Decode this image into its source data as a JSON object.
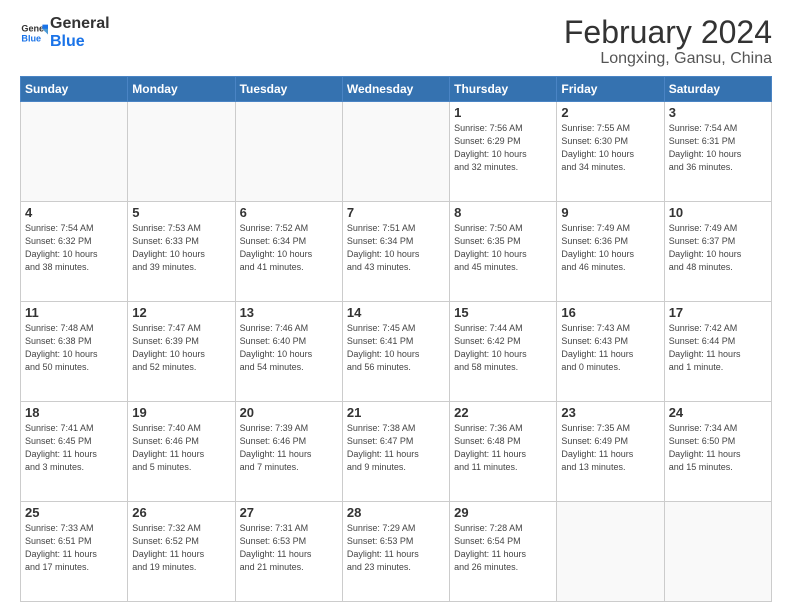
{
  "logo": {
    "line1": "General",
    "line2": "Blue"
  },
  "title": "February 2024",
  "subtitle": "Longxing, Gansu, China",
  "header_days": [
    "Sunday",
    "Monday",
    "Tuesday",
    "Wednesday",
    "Thursday",
    "Friday",
    "Saturday"
  ],
  "weeks": [
    [
      {
        "day": "",
        "info": ""
      },
      {
        "day": "",
        "info": ""
      },
      {
        "day": "",
        "info": ""
      },
      {
        "day": "",
        "info": ""
      },
      {
        "day": "1",
        "info": "Sunrise: 7:56 AM\nSunset: 6:29 PM\nDaylight: 10 hours\nand 32 minutes."
      },
      {
        "day": "2",
        "info": "Sunrise: 7:55 AM\nSunset: 6:30 PM\nDaylight: 10 hours\nand 34 minutes."
      },
      {
        "day": "3",
        "info": "Sunrise: 7:54 AM\nSunset: 6:31 PM\nDaylight: 10 hours\nand 36 minutes."
      }
    ],
    [
      {
        "day": "4",
        "info": "Sunrise: 7:54 AM\nSunset: 6:32 PM\nDaylight: 10 hours\nand 38 minutes."
      },
      {
        "day": "5",
        "info": "Sunrise: 7:53 AM\nSunset: 6:33 PM\nDaylight: 10 hours\nand 39 minutes."
      },
      {
        "day": "6",
        "info": "Sunrise: 7:52 AM\nSunset: 6:34 PM\nDaylight: 10 hours\nand 41 minutes."
      },
      {
        "day": "7",
        "info": "Sunrise: 7:51 AM\nSunset: 6:34 PM\nDaylight: 10 hours\nand 43 minutes."
      },
      {
        "day": "8",
        "info": "Sunrise: 7:50 AM\nSunset: 6:35 PM\nDaylight: 10 hours\nand 45 minutes."
      },
      {
        "day": "9",
        "info": "Sunrise: 7:49 AM\nSunset: 6:36 PM\nDaylight: 10 hours\nand 46 minutes."
      },
      {
        "day": "10",
        "info": "Sunrise: 7:49 AM\nSunset: 6:37 PM\nDaylight: 10 hours\nand 48 minutes."
      }
    ],
    [
      {
        "day": "11",
        "info": "Sunrise: 7:48 AM\nSunset: 6:38 PM\nDaylight: 10 hours\nand 50 minutes."
      },
      {
        "day": "12",
        "info": "Sunrise: 7:47 AM\nSunset: 6:39 PM\nDaylight: 10 hours\nand 52 minutes."
      },
      {
        "day": "13",
        "info": "Sunrise: 7:46 AM\nSunset: 6:40 PM\nDaylight: 10 hours\nand 54 minutes."
      },
      {
        "day": "14",
        "info": "Sunrise: 7:45 AM\nSunset: 6:41 PM\nDaylight: 10 hours\nand 56 minutes."
      },
      {
        "day": "15",
        "info": "Sunrise: 7:44 AM\nSunset: 6:42 PM\nDaylight: 10 hours\nand 58 minutes."
      },
      {
        "day": "16",
        "info": "Sunrise: 7:43 AM\nSunset: 6:43 PM\nDaylight: 11 hours\nand 0 minutes."
      },
      {
        "day": "17",
        "info": "Sunrise: 7:42 AM\nSunset: 6:44 PM\nDaylight: 11 hours\nand 1 minute."
      }
    ],
    [
      {
        "day": "18",
        "info": "Sunrise: 7:41 AM\nSunset: 6:45 PM\nDaylight: 11 hours\nand 3 minutes."
      },
      {
        "day": "19",
        "info": "Sunrise: 7:40 AM\nSunset: 6:46 PM\nDaylight: 11 hours\nand 5 minutes."
      },
      {
        "day": "20",
        "info": "Sunrise: 7:39 AM\nSunset: 6:46 PM\nDaylight: 11 hours\nand 7 minutes."
      },
      {
        "day": "21",
        "info": "Sunrise: 7:38 AM\nSunset: 6:47 PM\nDaylight: 11 hours\nand 9 minutes."
      },
      {
        "day": "22",
        "info": "Sunrise: 7:36 AM\nSunset: 6:48 PM\nDaylight: 11 hours\nand 11 minutes."
      },
      {
        "day": "23",
        "info": "Sunrise: 7:35 AM\nSunset: 6:49 PM\nDaylight: 11 hours\nand 13 minutes."
      },
      {
        "day": "24",
        "info": "Sunrise: 7:34 AM\nSunset: 6:50 PM\nDaylight: 11 hours\nand 15 minutes."
      }
    ],
    [
      {
        "day": "25",
        "info": "Sunrise: 7:33 AM\nSunset: 6:51 PM\nDaylight: 11 hours\nand 17 minutes."
      },
      {
        "day": "26",
        "info": "Sunrise: 7:32 AM\nSunset: 6:52 PM\nDaylight: 11 hours\nand 19 minutes."
      },
      {
        "day": "27",
        "info": "Sunrise: 7:31 AM\nSunset: 6:53 PM\nDaylight: 11 hours\nand 21 minutes."
      },
      {
        "day": "28",
        "info": "Sunrise: 7:29 AM\nSunset: 6:53 PM\nDaylight: 11 hours\nand 23 minutes."
      },
      {
        "day": "29",
        "info": "Sunrise: 7:28 AM\nSunset: 6:54 PM\nDaylight: 11 hours\nand 26 minutes."
      },
      {
        "day": "",
        "info": ""
      },
      {
        "day": "",
        "info": ""
      }
    ]
  ]
}
